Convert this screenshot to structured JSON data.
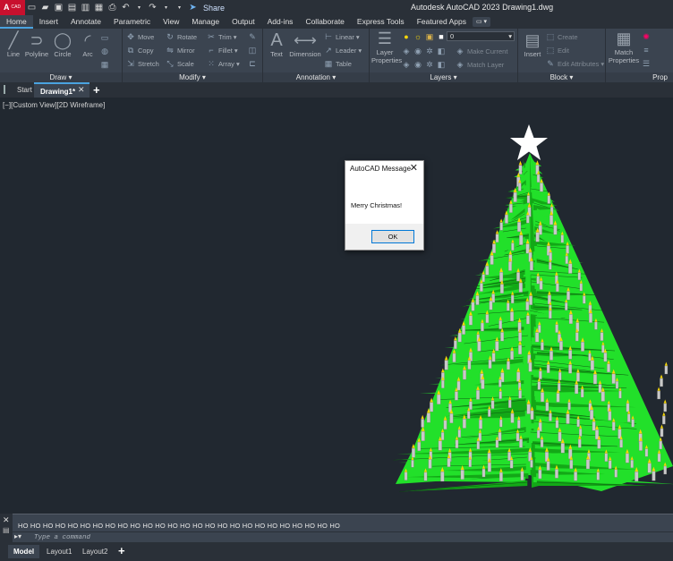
{
  "titlebar": {
    "logo_text": "A",
    "logo_sub": "CAD",
    "share_label": "Share",
    "app_title": "Autodesk AutoCAD 2023    Drawing1.dwg"
  },
  "ribbon_tabs": [
    "Home",
    "Insert",
    "Annotate",
    "Parametric",
    "View",
    "Manage",
    "Output",
    "Add-ins",
    "Collaborate",
    "Express Tools",
    "Featured Apps"
  ],
  "ribbon": {
    "draw": {
      "title": "Draw ▾",
      "line": "Line",
      "polyline": "Polyline",
      "circle": "Circle",
      "arc": "Arc"
    },
    "modify": {
      "title": "Modify ▾",
      "move": "Move",
      "rotate": "Rotate",
      "trim": "Trim ▾",
      "copy": "Copy",
      "mirror": "Mirror",
      "fillet": "Fillet ▾",
      "stretch": "Stretch",
      "scale": "Scale",
      "array": "Array ▾"
    },
    "annotation": {
      "title": "Annotation ▾",
      "text": "Text",
      "dimension": "Dimension",
      "linear": "Linear ▾",
      "leader": "Leader ▾",
      "table": "Table"
    },
    "layers": {
      "title": "Layers ▾",
      "layer_properties_1": "Layer",
      "layer_properties_2": "Properties",
      "make_current": "Make Current",
      "match_layer": "Match Layer",
      "layer_value": "0"
    },
    "block": {
      "title": "Block ▾",
      "insert": "Insert",
      "create": "Create",
      "edit": "Edit",
      "edit_attributes": "Edit Attributes ▾"
    },
    "properties": {
      "title": "Prop",
      "match_1": "Match",
      "match_2": "Properties"
    }
  },
  "filetabs": {
    "start": "Start",
    "drawing": "Drawing1*",
    "close": "✕",
    "add": "+"
  },
  "viewport": {
    "label": "[−][Custom View][2D Wireframe]"
  },
  "dialog": {
    "title": "AutoCAD Message",
    "close": "✕",
    "message": "Merry Christmas!",
    "ok": "OK"
  },
  "command": {
    "history": "HO HO HO HO HO HO HO HO HO HO HO HO HO HO HO HO HO HO HO HO HO HO HO HO HO HO",
    "placeholder": "Type a command",
    "close": "✕",
    "grip": "▤"
  },
  "layout_tabs": {
    "model": "Model",
    "layout1": "Layout1",
    "layout2": "Layout2",
    "add": "+"
  },
  "colors": {
    "tree_green": "#22e02a",
    "tree_dark_green": "#13a817",
    "flame": "#f5d60a",
    "candle": "#c9c9c9",
    "background": "#212830",
    "accent": "#4aa3e0"
  }
}
